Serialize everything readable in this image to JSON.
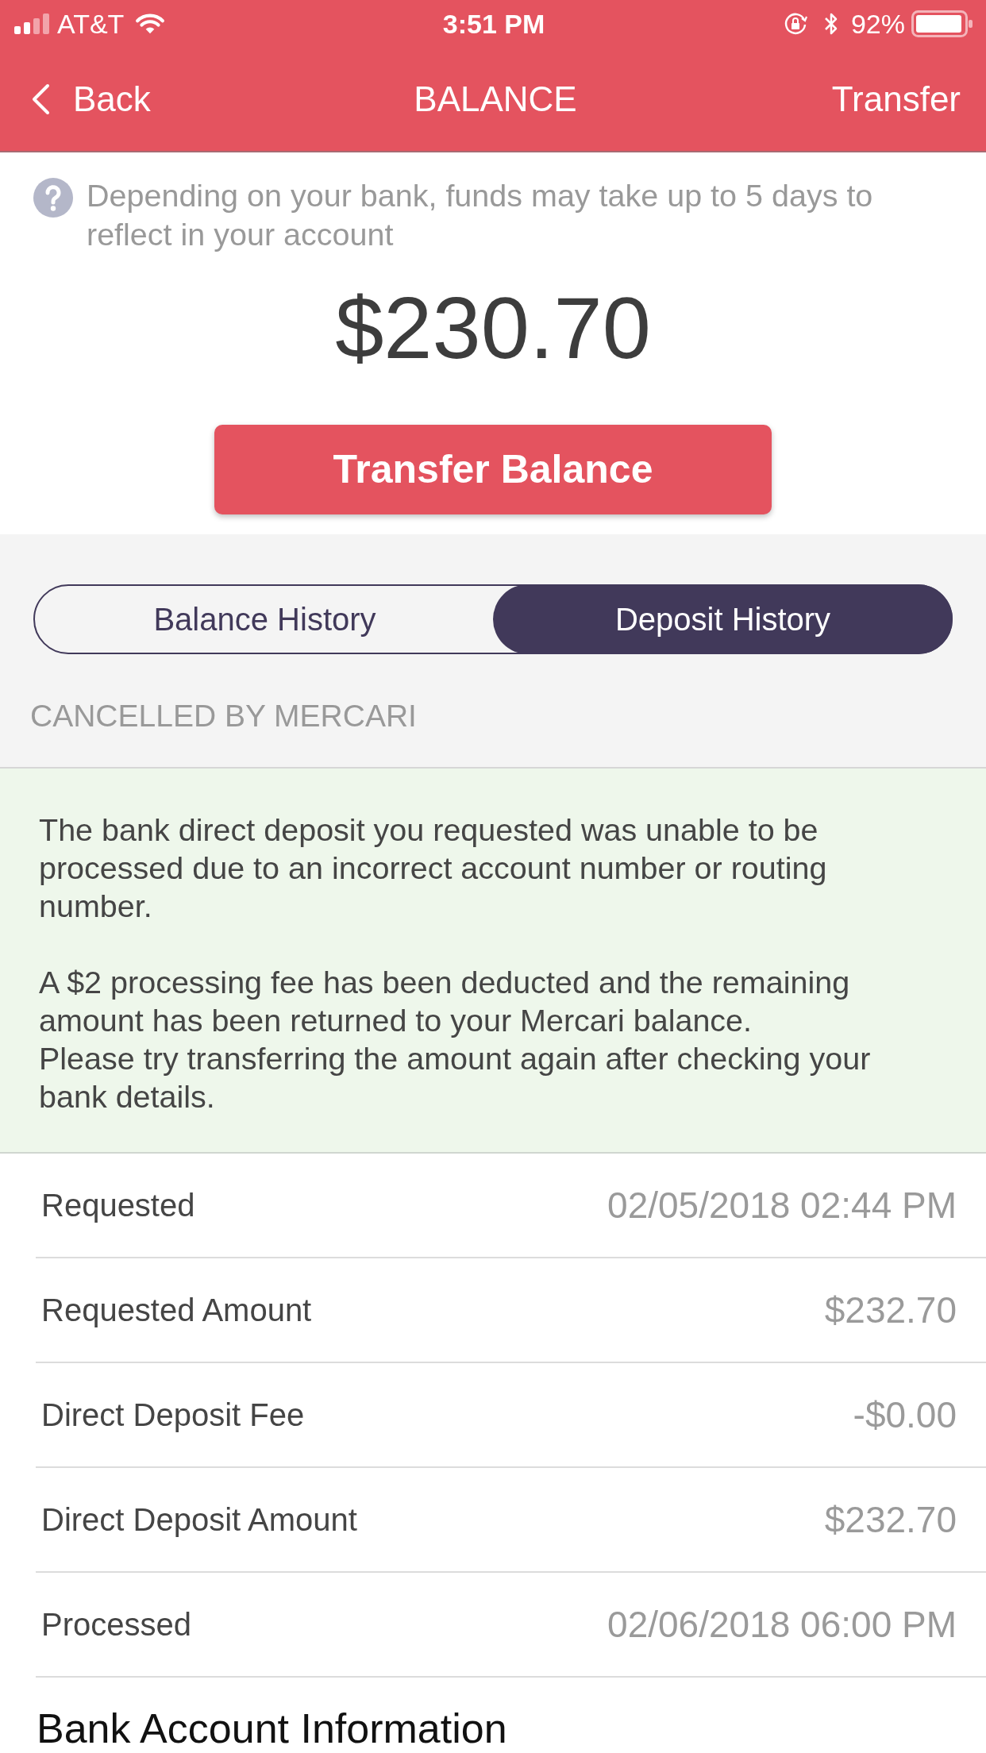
{
  "status_bar": {
    "carrier": "AT&T",
    "time": "3:51 PM",
    "battery": "92%"
  },
  "nav": {
    "back": "Back",
    "title": "BALANCE",
    "action": "Transfer"
  },
  "notice": "Depending on your bank, funds may take up to 5 days to reflect in your account",
  "balance": "$230.70",
  "transfer_button": "Transfer Balance",
  "tabs": [
    {
      "label": "Balance History",
      "selected": false
    },
    {
      "label": "Deposit History",
      "selected": true
    }
  ],
  "status_label": "CANCELLED BY MERCARI",
  "message": {
    "blocks": [
      [
        "The bank direct deposit you requested was unable to be processed due to an incorrect account number or routing number."
      ],
      [
        "A $2 processing fee has been deducted and the remaining amount has been returned to your Mercari balance.",
        "Please try transferring the amount again after checking your bank details."
      ]
    ]
  },
  "details": [
    {
      "label": "Requested",
      "value": "02/05/2018 02:44 PM"
    },
    {
      "label": "Requested Amount",
      "value": "$232.70"
    },
    {
      "label": "Direct Deposit Fee",
      "value": "-$0.00"
    },
    {
      "label": "Direct Deposit Amount",
      "value": "$232.70"
    },
    {
      "label": "Processed",
      "value": "02/06/2018 06:00 PM"
    }
  ],
  "section_heading": "Bank Account Information"
}
